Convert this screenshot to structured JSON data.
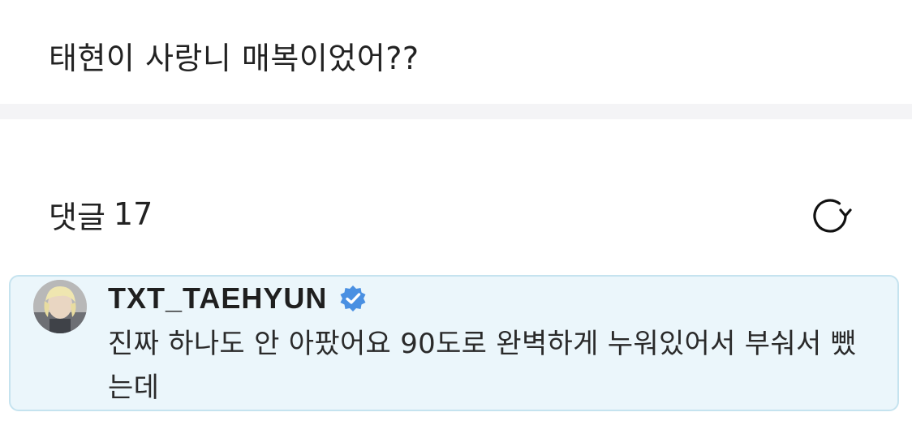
{
  "post": {
    "text": "태현이 사랑니 매복이었어??"
  },
  "comments": {
    "label": "댓글",
    "count": "17",
    "refresh_icon": "refresh-icon"
  },
  "highlighted_comment": {
    "author": "TXT_TAEHYUN",
    "verified_icon": "verified-badge-icon",
    "text": "진짜 하나도 안 아팠어요 90도로 완벽하게 누워있어서 부숴서 뺐는데",
    "colors": {
      "card_background": "#ebf6fb",
      "card_border": "#c5e3ef",
      "verified_badge": "#4a90e2"
    }
  }
}
